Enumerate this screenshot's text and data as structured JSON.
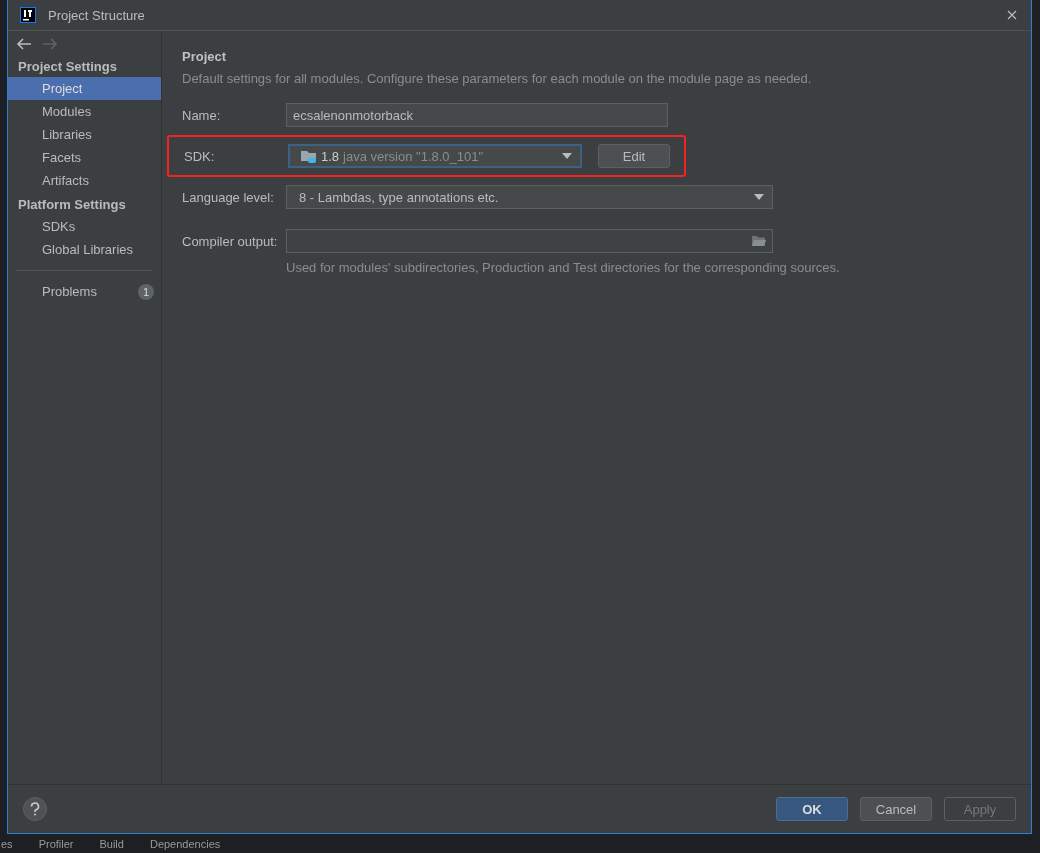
{
  "window": {
    "title": "Project Structure"
  },
  "navigation": {
    "back": {
      "disabled": false
    },
    "forward": {
      "disabled": true
    }
  },
  "sidebar": {
    "sections": [
      {
        "title": "Project Settings",
        "items": [
          {
            "label": "Project",
            "selected": true
          },
          {
            "label": "Modules",
            "selected": false
          },
          {
            "label": "Libraries",
            "selected": false
          },
          {
            "label": "Facets",
            "selected": false
          },
          {
            "label": "Artifacts",
            "selected": false
          }
        ]
      },
      {
        "title": "Platform Settings",
        "items": [
          {
            "label": "SDKs",
            "selected": false
          },
          {
            "label": "Global Libraries",
            "selected": false
          }
        ]
      }
    ],
    "problems": {
      "label": "Problems",
      "count": "1",
      "selected": false
    }
  },
  "content": {
    "title": "Project",
    "description": "Default settings for all modules. Configure these parameters for each module on the module page as needed.",
    "name": {
      "label": "Name:",
      "value": "ecsalenonmotorback"
    },
    "sdk": {
      "label": "SDK:",
      "version": "1.8",
      "detail": "java version \"1.8.0_101\"",
      "highlighted": true,
      "edit_button": "Edit"
    },
    "language_level": {
      "label": "Language level:",
      "value": "8 - Lambdas, type annotations etc."
    },
    "compiler_output": {
      "label": "Compiler output:",
      "hint": "Used for modules' subdirectories, Production and Test directories for the corresponding sources."
    }
  },
  "buttons": [
    {
      "label": "OK",
      "default": true,
      "disabled": false
    },
    {
      "label": "Cancel",
      "default": false,
      "disabled": false
    },
    {
      "label": "Apply",
      "default": false,
      "disabled": true
    }
  ],
  "background_toolbar": [
    "es",
    "Profiler",
    "Build",
    "Dependencies"
  ]
}
